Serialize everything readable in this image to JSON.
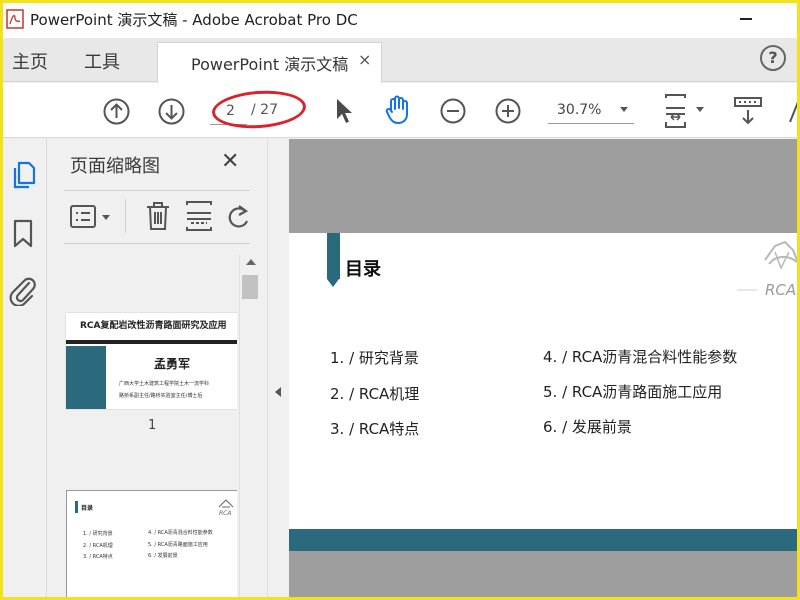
{
  "window": {
    "title": "PowerPoint 演示文稿 - Adobe Acrobat Pro DC",
    "logo_text": "Adobe Acrobat"
  },
  "tabs": {
    "home": "主页",
    "tools": "工具",
    "document": "PowerPoint 演示文稿",
    "close_glyph": "×",
    "help_glyph": "?"
  },
  "toolbar": {
    "current_page": "2",
    "total_pages": "/ 27",
    "zoom": "30.7%"
  },
  "sidebar": {
    "title": "页面缩略图",
    "close_glyph": "✕",
    "thumbnails": [
      {
        "page_number": "1",
        "title": "RCA复配岩改性沥青路面研究及应用",
        "author": "孟勇军",
        "line1": "广西大学土木建筑工程学院土木一流学科",
        "line2": "路桥系副主任/路桥实验室主任/博士后"
      },
      {
        "heading": "目录",
        "items": [
          "1. / 研究背景",
          "2. / RCA机理",
          "3. / RCA特点",
          "4. / RCA沥青混合料性能参数",
          "5. / RCA沥青路面施工应用",
          "6. / 发展前景"
        ]
      }
    ]
  },
  "document": {
    "heading": "目录",
    "toc": {
      "left": [
        "1. / 研究背景",
        "2. / RCA机理",
        "3. / RCA特点"
      ],
      "right": [
        "4. / RCA沥青混合料性能参数",
        "5. / RCA沥青路面施工应用",
        "6. / 发展前景"
      ]
    },
    "logo_text": "RCA"
  },
  "colors": {
    "accent_teal": "#2a6a7c",
    "highlight_red": "#d8232a",
    "acrobat_blue": "#1473e6",
    "frame_yellow": "#f2e21c"
  }
}
